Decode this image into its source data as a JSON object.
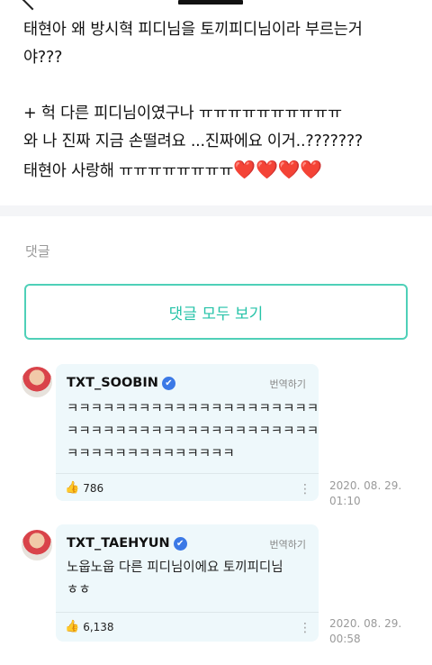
{
  "post": {
    "lines": [
      "태현아 왜 방시혁 피디님을 토끼피디님이라 부르는거",
      "야???",
      "+ 헉 다른 피디님이였구나 ㅠㅠㅠㅠㅠㅠㅠㅠㅠㅠ",
      "와 나 진짜 지금 손떨려요 ...진짜에요 이거..???????",
      "태현아 사랑해 ㅠㅠㅠㅠㅠㅠㅠㅠ"
    ],
    "hearts": "❤️❤️❤️❤️"
  },
  "comments_section": {
    "label": "댓글",
    "view_all_label": "댓글 모두 보기"
  },
  "comments": [
    {
      "author": "TXT_SOOBIN",
      "verified_icon": "✔",
      "translate_label": "번역하기",
      "lines": [
        "ㅋㅋㅋㅋㅋㅋㅋㅋㅋㅋㅋㅋㅋㅋㅋㅋㅋㅋㅋㅋㅋ",
        "ㅋㅋㅋㅋㅋㅋㅋㅋㅋㅋㅋㅋㅋㅋㅋㅋㅋㅋㅋㅋㅋ",
        "ㅋㅋㅋㅋㅋㅋㅋㅋㅋㅋㅋㅋㅋㅋ"
      ],
      "likes": "786",
      "date": "2020. 08. 29.",
      "time": "01:10"
    },
    {
      "author": "TXT_TAEHYUN",
      "verified_icon": "✔",
      "translate_label": "번역하기",
      "lines": [
        "노웁노웁 다른 피디님이에요 토끼피디님",
        "ㅎㅎ"
      ],
      "likes": "6,138",
      "date": "2020. 08. 29.",
      "time": "00:58"
    }
  ],
  "icons": {
    "thumb": "👍",
    "more": "⋮"
  },
  "colors": {
    "accent": "#26c3a8",
    "bubble": "#eef8fb",
    "verified": "#3b79e6",
    "heart": "#e53935"
  }
}
